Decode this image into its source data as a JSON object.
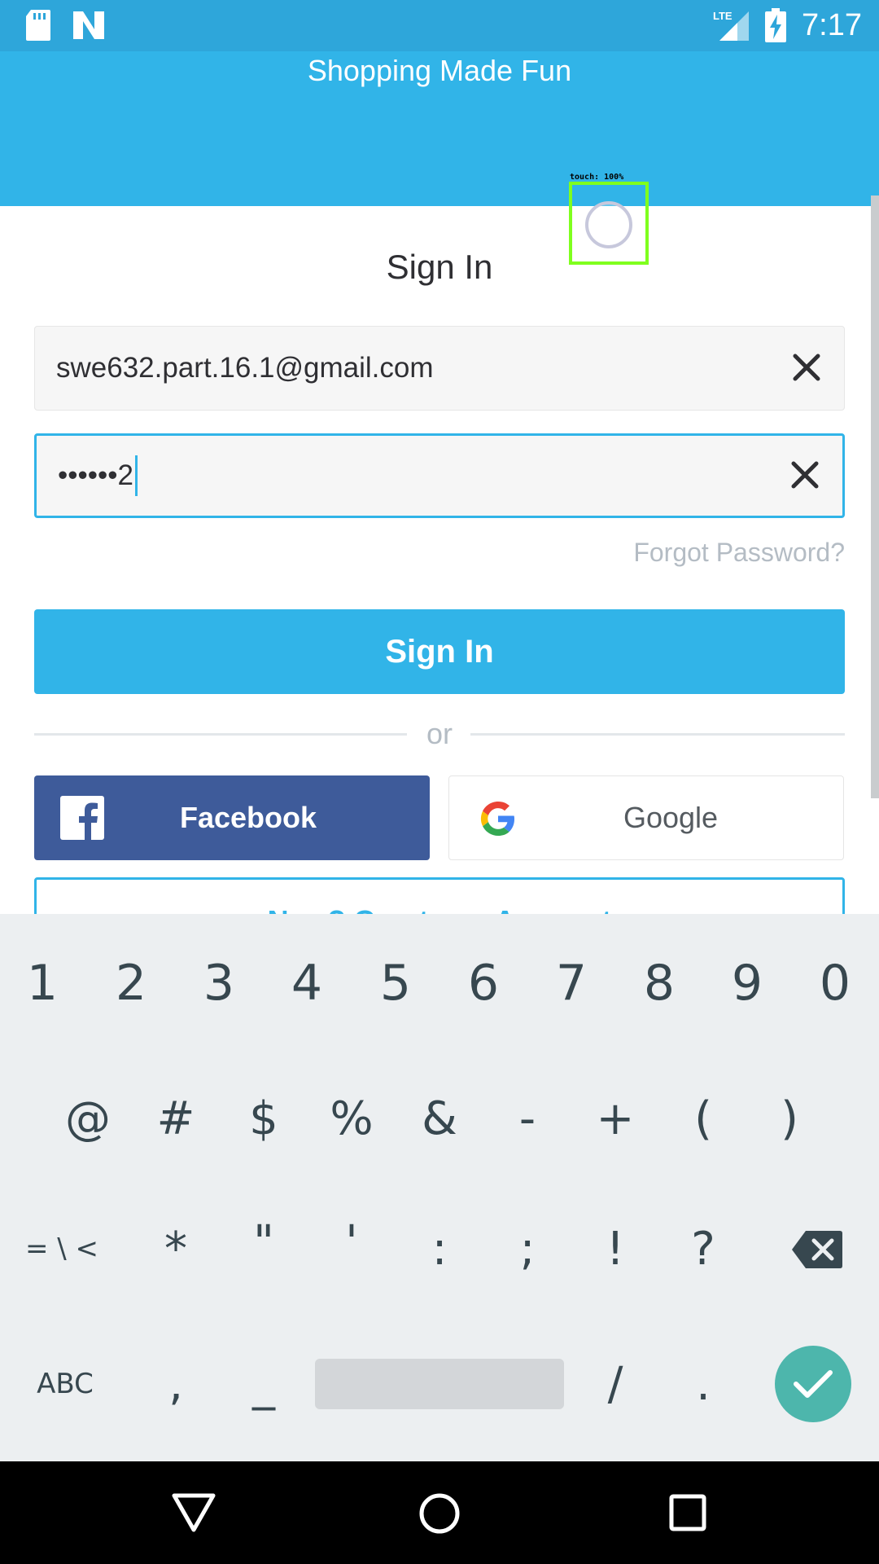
{
  "status_bar": {
    "time": "7:17",
    "network": "LTE"
  },
  "header": {
    "tagline": "Shopping Made Fun"
  },
  "touch_indicator": {
    "label": "touch: 100%"
  },
  "sign_in": {
    "title": "Sign In",
    "email_value": "swe632.part.16.1@gmail.com",
    "password_value": "••••••2",
    "forgot_label": "Forgot Password?",
    "submit_label": "Sign In",
    "or_label": "or",
    "facebook_label": "Facebook",
    "google_label": "Google",
    "create_account_label": "New? Create an Account"
  },
  "keyboard": {
    "row1": [
      "1",
      "2",
      "3",
      "4",
      "5",
      "6",
      "7",
      "8",
      "9",
      "0"
    ],
    "row2": [
      "@",
      "#",
      "$",
      "%",
      "&",
      "-",
      "+",
      "(",
      ")"
    ],
    "row3": [
      "= \\ <",
      "*",
      "\"",
      "'",
      ":",
      ";",
      "!",
      "?"
    ],
    "row4": [
      "ABC",
      ",",
      "_",
      "/",
      "."
    ]
  },
  "colors": {
    "accent": "#31b4e8",
    "facebook": "#3e5b9a",
    "enter": "#4db6ac"
  }
}
